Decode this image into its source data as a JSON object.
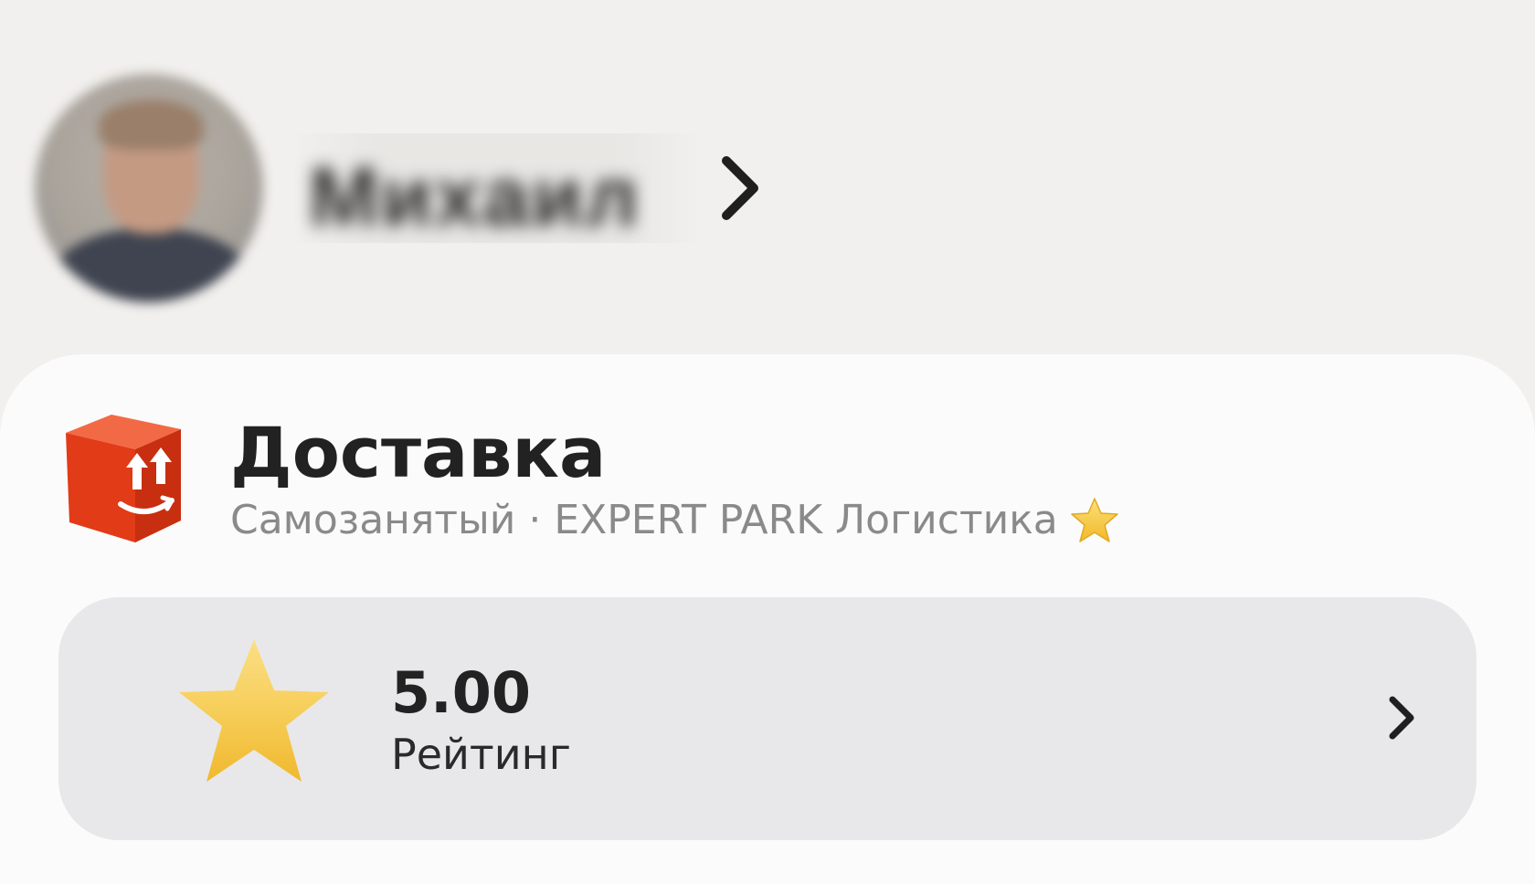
{
  "profile": {
    "name": "Михаил",
    "avatar_icon": "user-photo-blurred",
    "open_icon": "chevron-right-icon"
  },
  "service": {
    "icon": "delivery-box-icon",
    "title": "Доставка",
    "subtitle": "Самозанятый · EXPERT PARK Логистика",
    "badge_icon": "star-icon"
  },
  "rating": {
    "icon": "star-icon",
    "value": "5.00",
    "label": "Рейтинг",
    "open_icon": "chevron-right-icon"
  },
  "colors": {
    "background": "#f2f0ee",
    "card": "#fbfbfb",
    "rating_block": "#e8e8ea",
    "brand_orange": "#e8401c",
    "star": "#f3c13a",
    "text_primary": "#222222",
    "text_secondary": "#8a8a8a"
  }
}
